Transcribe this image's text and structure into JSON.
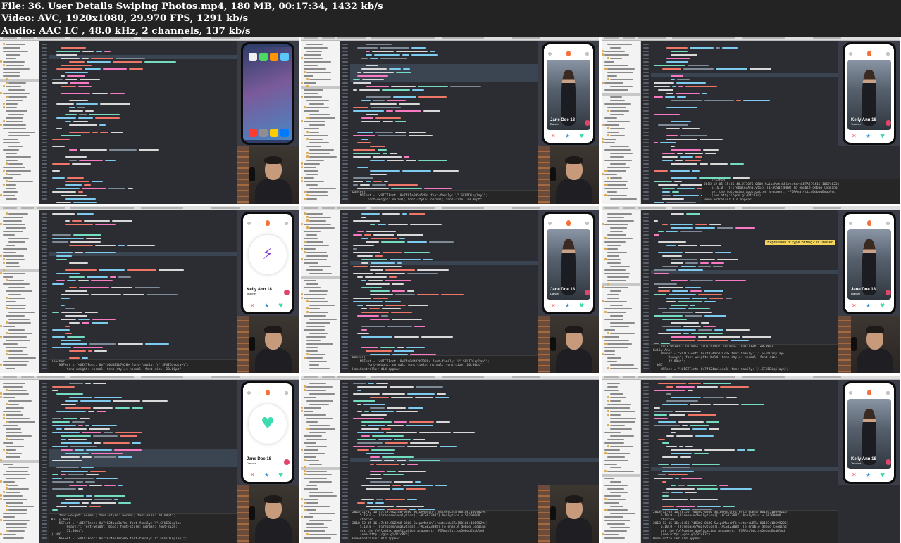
{
  "header": {
    "file_line": "File: 36. User Details Swiping Photos.mp4, 180 MB, 00:17:34, 1432 kb/s",
    "video_line": "Video: AVC, 1920x1080, 29.970 FPS, 1291 kb/s",
    "audio_line": "Audio: AAC LC , 48.0 kHz, 2 channels, 137 kb/s"
  },
  "tiles": [
    {
      "screen": "home",
      "card_name": "",
      "card_role": "",
      "console": [],
      "warning": ""
    },
    {
      "screen": "photo",
      "card_name": "Jane Doe 18",
      "card_role": "Dancer",
      "console": [
        "Dancer(",
        "    NSFont = \"<UICTFont: 0x7f91a595a5d0> font-family: \\\".SFUIDisplay\\\";",
        "        font-weight: normal; font-style: normal; font-size: 20.00pt\";"
      ],
      "warning": ""
    },
    {
      "screen": "photo",
      "card_name": "Kelly Ann 18",
      "card_role": "Teacher",
      "console": [
        "    started",
        "2018-12-05 15:36:48.277076-0800 SwipeMatchFirestoreLBTA[79416:10674623]",
        "    5.10.0 - [Firebase/Analytics][I-ACS023008] To enable debug logging",
        "    set the following application argument: -FIRAnalyticsDebugEnabled",
        "    (see http://goo.gl/RfcP7r)",
        "HomeController did appear"
      ],
      "warning": ""
    },
    {
      "screen": "icon-bolt",
      "card_name": "Kelly Ann 18",
      "card_role": "Teacher",
      "console": [
        "Teacher(",
        "    NSFont = \"<UICTFont: 0x7fd0dd82b7020> font-family: \\\".SFUIDisplay\\\";",
        "        font-weight: normal; font-style: normal; font-size: 20.00pt\";"
      ],
      "warning": ""
    },
    {
      "screen": "photo",
      "card_name": "Jane Doe 18",
      "card_role": "Dancer",
      "console": [
        "Dancer(",
        "    NSFont = \"<UICTFont: 0x7fd0dd82b7020> font-family: \\\".SFUIDisplay\\\";",
        "        font-weight: normal; font-style: normal; font-size: 20.00pt\";",
        "HomeController did appear"
      ],
      "warning": ""
    },
    {
      "screen": "photo",
      "card_name": "Jane Doe 18",
      "card_role": "Dancer",
      "console": [
        "    font-weight: normal; font-style: normal; font-size: 20.00pt\";",
        "Kelly Ann(",
        "    NSFont = \"<UICTFont: 0x7f824acd3a70> font-family: \\\".SFUIDisplay-",
        "        Heavy\\\"; font-weight: bold; font-style: normal; font-size:",
        "        32.00pt\";",
        ") $BC",
        "    NSFont = \"<UICTFont: 0x7f824ac1ece0> font-family: \\\".SFUIDisplay\\\";"
      ],
      "warning": "Expression of type 'String?' is unused"
    },
    {
      "screen": "icon-heart",
      "card_name": "Jane Doe 18",
      "card_role": "Dancer",
      "console": [
        "    font-weight: normal; font-style: normal; font-size: 20.00pt\";",
        "Kelly Ann(",
        "    NSFont = \"<UICTFont: 0x7f824acd3a70> font-family: \\\".SFUIDisplay-",
        "        Heavy\\\"; font-weight: bold; font-style: normal; font-size:",
        "        32.00pt\";",
        ") $BC",
        "    NSFont = \"<UICTFont: 0x7f824ac1ece0> font-family: \\\".SFUIDisplay\\\";"
      ],
      "warning": ""
    },
    {
      "screen": "none",
      "card_name": "",
      "card_role": "",
      "console": [
        "2018-12-05 16:47:49.962288-0800 SwipeMatchFirestoreLBTA[80180:10698294]",
        "    5.10.0 - [Firebase/Analytics][I-ACS023007] Analytics v.50200000",
        "    started",
        "2018-12-05 16:47:49.962288-0800 SwipeMatchFirestoreLBTA[80180:10698294]",
        "    5.10.0 - [Firebase/Analytics][I-ACS023008] To enable debug logging",
        "    set the following application argument: -FIRAnalyticsDebugEnabled",
        "    (see http://goo.gl/RfcP7r)",
        "HomeController did appear"
      ],
      "warning": ""
    },
    {
      "screen": "photo",
      "card_name": "Kelly Ann 18",
      "card_role": "Teacher",
      "console": [
        "2018-12-05 16:48:56.746302-0800 SwipeMatchFirestoreLBTA[80193:10699226]",
        "    5.10.0 - [Firebase/Analytics][I-ACS023007] Analytics v.50200000",
        "    started",
        "2018-12-05 16:48:56.746302-0800 SwipeMatchFirestoreLBTA[80193:10699226]",
        "    5.10.0 - [Firebase/Analytics][I-ACS023008] To enable debug logging",
        "    set the following application argument: -FIRAnalyticsDebugEnabled",
        "    (see http://goo.gl/RfcP7r)",
        "HomeController did appear"
      ],
      "warning": ""
    }
  ],
  "colors": {
    "header_bg": "#232323",
    "editor_bg": "#2b2d33",
    "keyword": "#f97ac2",
    "type": "#7ecbf0",
    "string": "#f07667",
    "comment": "#7e8b97",
    "plain": "#d9d9d9",
    "function": "#73dcc1",
    "highlight_line": "#3b4552",
    "brand_flame": "#f3723c"
  },
  "icons": {
    "dismiss": "x-icon",
    "super_like": "star-icon",
    "like": "heart-icon",
    "info": "info-icon",
    "flame": "flame-icon"
  }
}
